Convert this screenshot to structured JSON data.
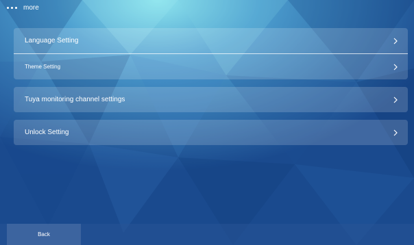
{
  "header": {
    "title": "more",
    "menu_icon": "more-dots-icon"
  },
  "settings": {
    "group1": [
      {
        "label": "Language Setting",
        "icon": "chevron-right-icon"
      },
      {
        "label": "Theme Setting",
        "icon": "chevron-right-icon"
      }
    ],
    "tuya": {
      "label": "Tuya monitoring channel settings",
      "icon": "chevron-right-icon"
    },
    "unlock": {
      "label": "Unlock Setting",
      "icon": "chevron-right-icon"
    }
  },
  "footer": {
    "back_label": "Back"
  },
  "colors": {
    "background": "#1f4f92",
    "panel": "rgba(255,255,255,0.17)",
    "text": "#ffffff"
  }
}
